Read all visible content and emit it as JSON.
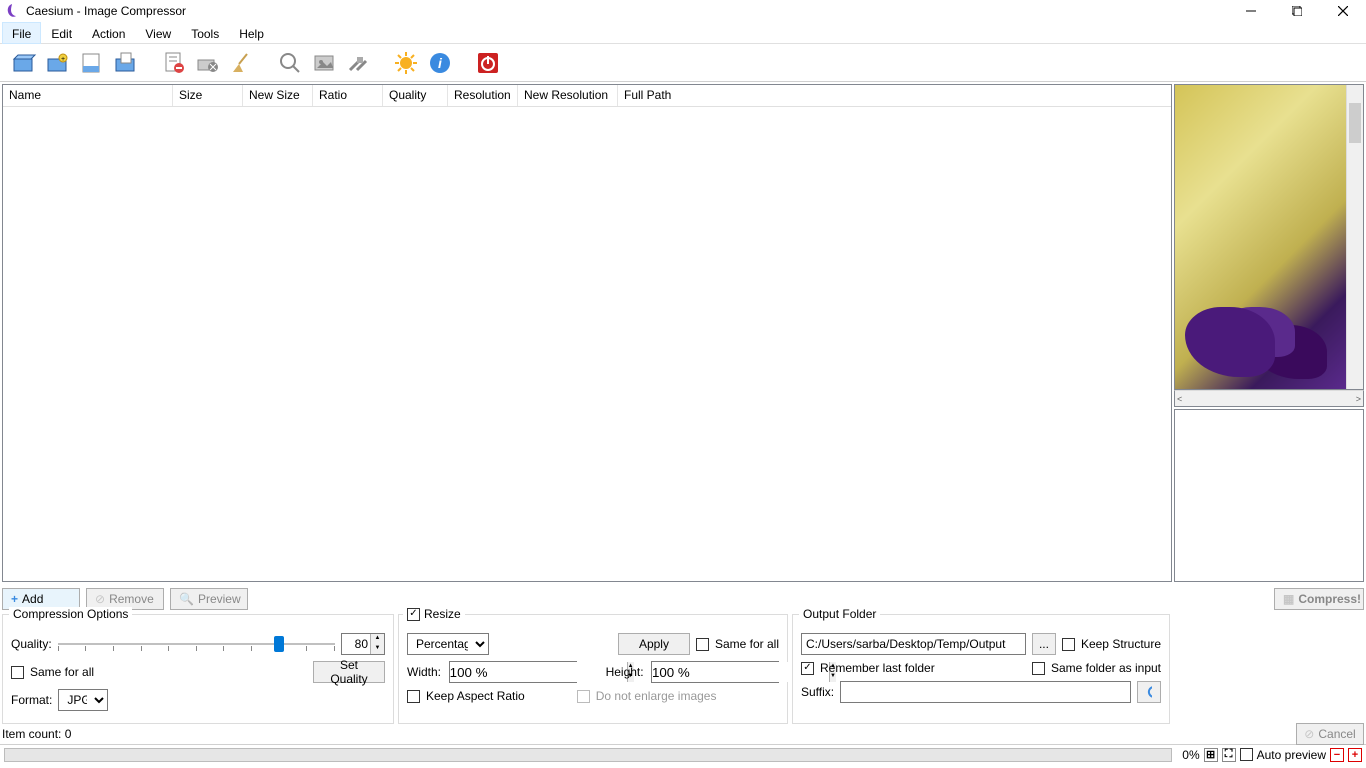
{
  "window": {
    "title": "Caesium - Image Compressor"
  },
  "menu": {
    "items": [
      "File",
      "Edit",
      "Action",
      "View",
      "Tools",
      "Help"
    ],
    "active_index": 0
  },
  "list": {
    "columns": [
      "Name",
      "Size",
      "New Size",
      "Ratio",
      "Quality",
      "Resolution",
      "New Resolution",
      "Full Path"
    ]
  },
  "action_buttons": {
    "add": "Add",
    "remove": "Remove",
    "preview": "Preview",
    "compress": "Compress!"
  },
  "compression": {
    "legend": "Compression Options",
    "quality_label": "Quality:",
    "quality_value": "80",
    "set_quality": "Set Quality",
    "same_for_all": "Same for all",
    "format_label": "Format:",
    "format_value": "JPG"
  },
  "resize": {
    "legend": "Resize",
    "mode": "Percentage",
    "apply": "Apply",
    "same_for_all": "Same for all",
    "width_label": "Width:",
    "width_value": "100 %",
    "height_label": "Height:",
    "height_value": "100 %",
    "keep_aspect": "Keep Aspect Ratio",
    "no_enlarge": "Do not enlarge images"
  },
  "output": {
    "legend": "Output Folder",
    "path": "C:/Users/sarba/Desktop/Temp/Output",
    "browse": "...",
    "keep_structure": "Keep Structure",
    "remember": "Remember last folder",
    "same_as_input": "Same folder as input",
    "suffix_label": "Suffix:",
    "suffix_value": ""
  },
  "status": {
    "item_count": "Item count: 0",
    "cancel": "Cancel"
  },
  "bottombar": {
    "percent": "0%",
    "auto_preview": "Auto preview"
  }
}
